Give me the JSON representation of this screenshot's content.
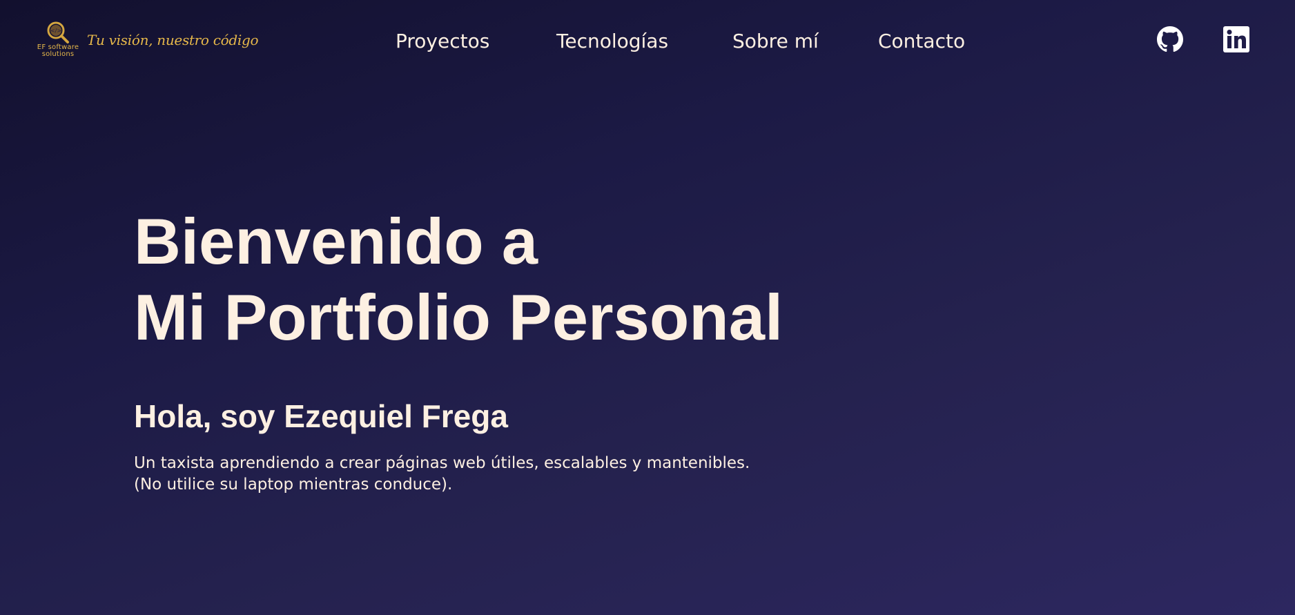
{
  "header": {
    "logo": {
      "company": "EF software solutions",
      "tagline": "Tu visión, nuestro código"
    },
    "nav": [
      {
        "label": "Proyectos"
      },
      {
        "label": "Tecnologías"
      },
      {
        "label": "Sobre mí"
      },
      {
        "label": "Contacto"
      }
    ],
    "social": [
      {
        "icon": "github-icon"
      },
      {
        "icon": "linkedin-icon"
      }
    ]
  },
  "hero": {
    "title_line1": "Bienvenido a",
    "title_line2": "Mi Portfolio Personal",
    "greeting": "Hola, soy Ezequiel Frega",
    "description_line1": "Un taxista aprendiendo a crear páginas web útiles, escalables y mantenibles.",
    "description_line2": "(No utilice su laptop mientras conduce)."
  },
  "colors": {
    "background_start": "#12102e",
    "background_end": "#2d2760",
    "text": "#fdf0e2",
    "accent_gold": "#e6b84a"
  }
}
